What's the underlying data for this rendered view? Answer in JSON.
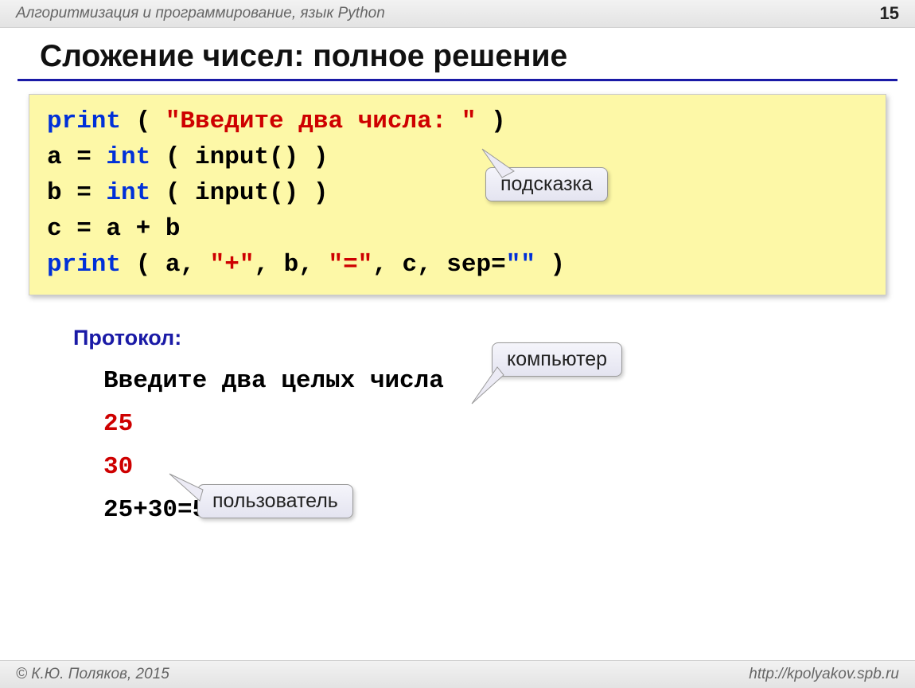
{
  "header": {
    "subject": "Алгоритмизация и программирование,  язык Python",
    "page": "15"
  },
  "title": "Сложение чисел: полное решение",
  "code": {
    "l1_print": "print",
    "l1_open": " ( ",
    "l1_str": "\"Введите два числа: \"",
    "l1_close": " )",
    "l2": "a = ",
    "l2_int": "int",
    "l2_rest": " ( input() )",
    "l3": "b = ",
    "l3_int": "int",
    "l3_rest": " ( input() )",
    "l4": "c = a + b",
    "l5_print": "print",
    "l5_open": " ( a, ",
    "l5_plus": "\"+\"",
    "l5_mid1": ", b, ",
    "l5_eq": "\"=\"",
    "l5_mid2": ", c, sep=",
    "l5_empty": "\"\"",
    "l5_close": " )"
  },
  "callouts": {
    "hint": "подсказка",
    "computer": "компьютер",
    "user": "пользователь"
  },
  "protocol": {
    "label": "Протокол:",
    "prompt": "Введите два целых числа",
    "in1": "25",
    "in2": "30",
    "out": "25+30=55"
  },
  "footer": {
    "left": "© К.Ю. Поляков, 2015",
    "right": "http://kpolyakov.spb.ru"
  }
}
